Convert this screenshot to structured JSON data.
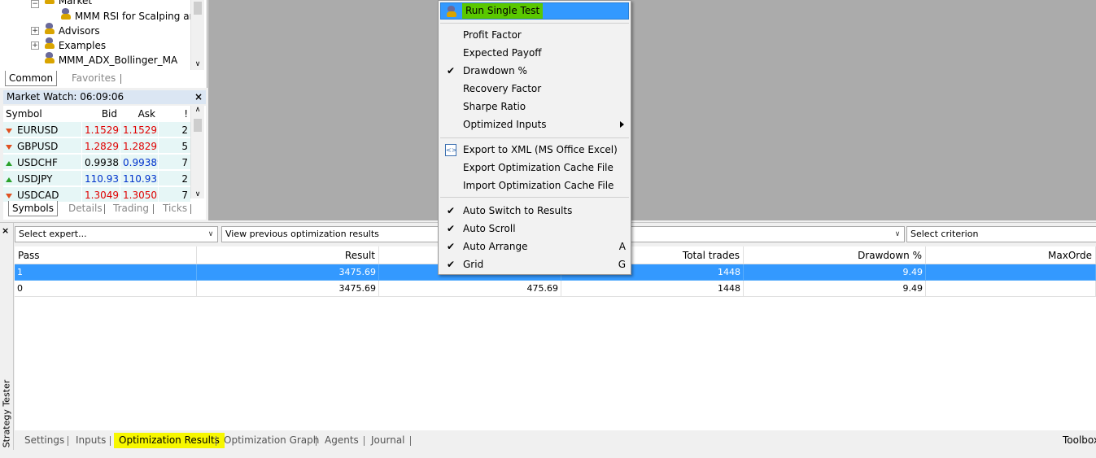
{
  "navigator": {
    "items": [
      {
        "label": "Market"
      },
      {
        "label": "MMM RSI for Scalping and"
      },
      {
        "label": "Advisors"
      },
      {
        "label": "Examples"
      },
      {
        "label": "MMM_ADX_Bollinger_MA"
      }
    ],
    "tabs": [
      "Common",
      "Favorites"
    ]
  },
  "market_watch": {
    "title": "Market Watch: 06:09:06",
    "columns": [
      "Symbol",
      "Bid",
      "Ask",
      "!"
    ],
    "rows": [
      {
        "symbol": "EURUSD",
        "bid": "1.15290",
        "ask": "1.15292",
        "spread": "2",
        "dir": "down"
      },
      {
        "symbol": "GBPUSD",
        "bid": "1.28292",
        "ask": "1.28297",
        "spread": "5",
        "dir": "down"
      },
      {
        "symbol": "USDCHF",
        "bid": "0.99382",
        "ask": "0.99389",
        "spread": "7",
        "dir": "up"
      },
      {
        "symbol": "USDJPY",
        "bid": "110.931",
        "ask": "110.933",
        "spread": "2",
        "dir": "up"
      },
      {
        "symbol": "USDCAD",
        "bid": "1.30496",
        "ask": "1.30503",
        "spread": "7",
        "dir": "down"
      }
    ],
    "tabs": [
      "Symbols",
      "Details",
      "Trading",
      "Ticks"
    ]
  },
  "tester": {
    "side_label": "Strategy Tester",
    "combos": {
      "expert": "Select expert...",
      "previous": "View previous optimization results",
      "criterion": "Select criterion"
    },
    "columns": [
      "Pass",
      "Result",
      "",
      "Total trades",
      "Drawdown %",
      "MaxOrde"
    ],
    "rows": [
      {
        "pass": "1",
        "result": "3475.69",
        "profit": "",
        "trades": "1448",
        "drawdown": "9.49"
      },
      {
        "pass": "0",
        "result": "3475.69",
        "profit": "475.69",
        "trades": "1448",
        "drawdown": "9.49"
      }
    ],
    "tabs": [
      "Settings",
      "Inputs",
      "Optimization Results",
      "Optimization Graph",
      "Agents",
      "Journal"
    ],
    "toolbox": "Toolbox"
  },
  "context_menu": {
    "run_single_test": "Run Single Test",
    "group1": [
      {
        "label": "Profit Factor",
        "checked": false
      },
      {
        "label": "Expected Payoff",
        "checked": false
      },
      {
        "label": "Drawdown %",
        "checked": true
      },
      {
        "label": "Recovery Factor",
        "checked": false
      },
      {
        "label": "Sharpe Ratio",
        "checked": false
      },
      {
        "label": "Optimized Inputs",
        "checked": false
      }
    ],
    "group2": [
      {
        "label": "Export to XML (MS Office Excel)"
      },
      {
        "label": "Export Optimization Cache File"
      },
      {
        "label": "Import Optimization Cache File"
      }
    ],
    "group3": [
      {
        "label": "Auto Switch to Results",
        "shortcut": ""
      },
      {
        "label": "Auto Scroll",
        "shortcut": ""
      },
      {
        "label": "Auto Arrange",
        "shortcut": "A"
      },
      {
        "label": "Grid",
        "shortcut": "G"
      }
    ]
  },
  "colors": {
    "selection": "#3399ff",
    "highlight_green": "#5ac800",
    "highlight_yellow": "#f7f700",
    "bid_down": "#e00000",
    "bid_up": "#0033cc"
  }
}
